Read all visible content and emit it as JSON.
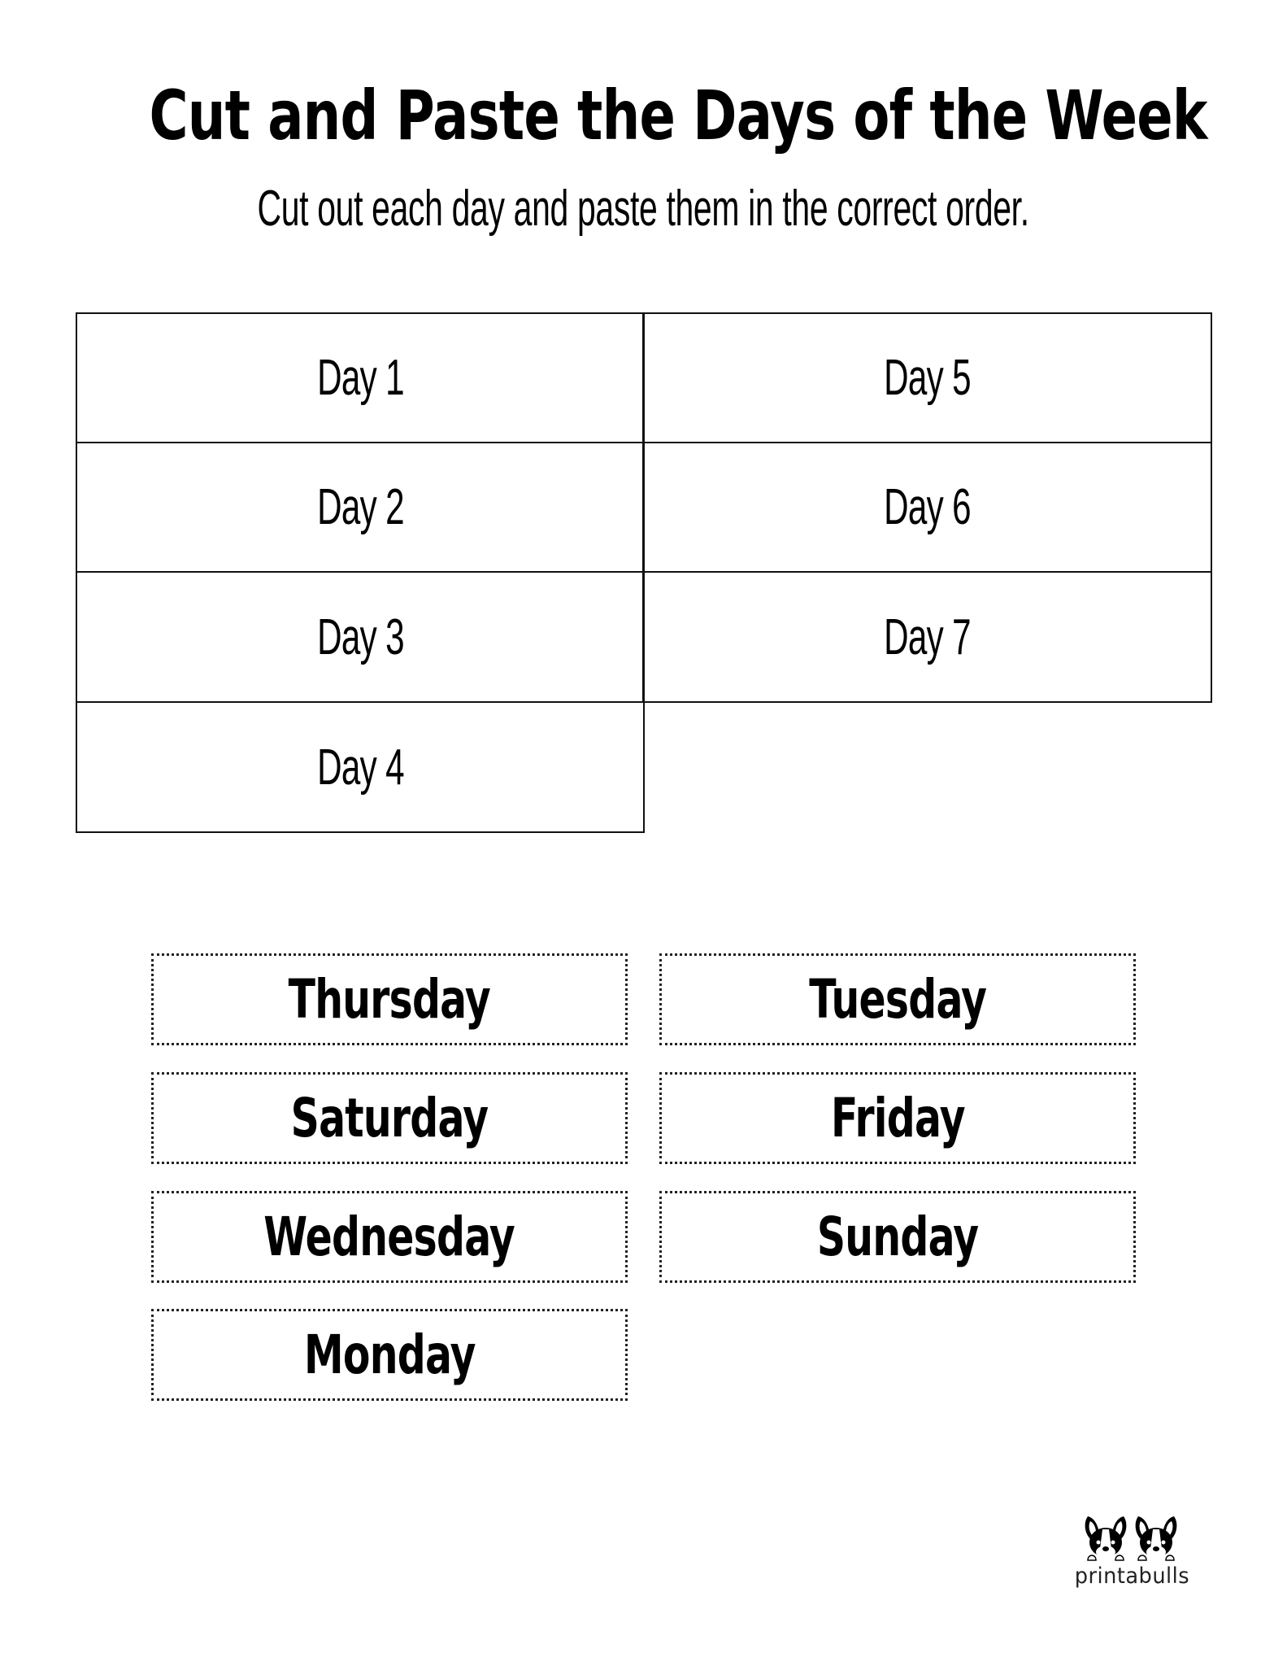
{
  "worksheet": {
    "title": "Cut and Paste the Days of the Week",
    "instructions": "Cut out each day and paste them in the correct order."
  },
  "answer_grid": {
    "slots": [
      {
        "label": "Day 1"
      },
      {
        "label": "Day 2"
      },
      {
        "label": "Day 3"
      },
      {
        "label": "Day 4"
      },
      {
        "label": "Day 5"
      },
      {
        "label": "Day 6"
      },
      {
        "label": "Day 7"
      }
    ]
  },
  "cutouts": {
    "cards": [
      {
        "label": "Thursday"
      },
      {
        "label": "Tuesday"
      },
      {
        "label": "Saturday"
      },
      {
        "label": "Friday"
      },
      {
        "label": "Wednesday"
      },
      {
        "label": "Sunday"
      },
      {
        "label": "Monday"
      }
    ]
  },
  "branding": {
    "logo_text": "printabulls",
    "logo_icon": "french-bulldogs-icon"
  },
  "colors": {
    "ink": "#000000",
    "background": "#ffffff"
  }
}
